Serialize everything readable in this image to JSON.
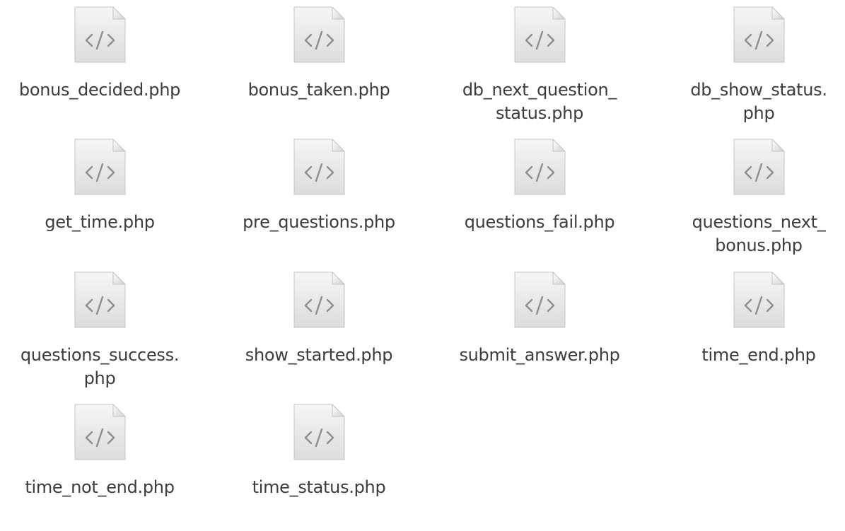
{
  "window": {
    "view": "icon-grid"
  },
  "files": [
    {
      "name": "bonus_decided.php",
      "icon": "php-code-file-icon"
    },
    {
      "name": "bonus_taken.php",
      "icon": "php-code-file-icon"
    },
    {
      "name": "db_next_question_\nstatus.php",
      "icon": "php-code-file-icon"
    },
    {
      "name": "db_show_status.\nphp",
      "icon": "php-code-file-icon"
    },
    {
      "name": "get_time.php",
      "icon": "php-code-file-icon"
    },
    {
      "name": "pre_questions.php",
      "icon": "php-code-file-icon"
    },
    {
      "name": "questions_fail.php",
      "icon": "php-code-file-icon"
    },
    {
      "name": "questions_next_\nbonus.php",
      "icon": "php-code-file-icon"
    },
    {
      "name": "questions_success.\nphp",
      "icon": "php-code-file-icon"
    },
    {
      "name": "show_started.php",
      "icon": "php-code-file-icon"
    },
    {
      "name": "submit_answer.php",
      "icon": "php-code-file-icon"
    },
    {
      "name": "time_end.php",
      "icon": "php-code-file-icon"
    },
    {
      "name": "time_not_end.php",
      "icon": "php-code-file-icon"
    },
    {
      "name": "time_status.php",
      "icon": "php-code-file-icon"
    }
  ]
}
